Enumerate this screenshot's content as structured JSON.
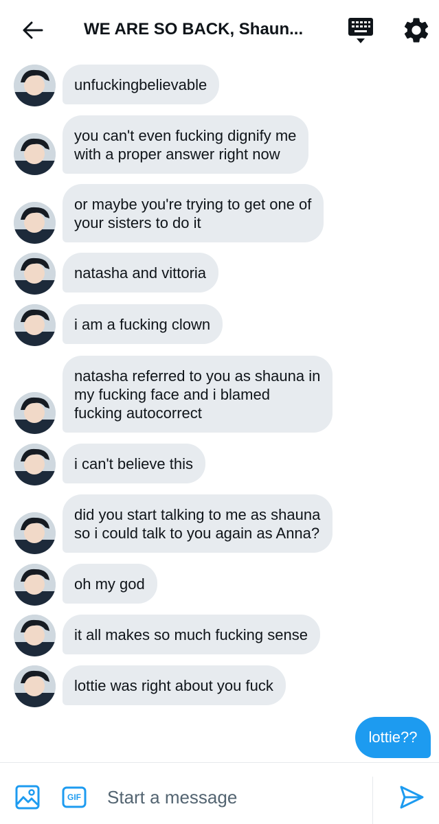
{
  "header": {
    "title": "WE ARE SO BACK, Shaun...",
    "back_icon": "arrow-left-icon",
    "keyboard_icon": "keyboard-icon",
    "settings_icon": "gear-icon"
  },
  "messages": [
    {
      "text": "unfuckingbelievable"
    },
    {
      "text": "you can't even fucking dignify me\nwith a proper answer right now"
    },
    {
      "text": "or maybe you're trying to get one of\nyour sisters to do it"
    },
    {
      "text": "natasha and vittoria"
    },
    {
      "text": "i am a fucking clown"
    },
    {
      "text": "natasha referred to you as shauna in\nmy fucking face and i blamed\nfucking autocorrect"
    },
    {
      "text": "i can't believe this"
    },
    {
      "text": "did you start talking to me as shauna\nso i could talk to you again as Anna?"
    },
    {
      "text": "oh my god"
    },
    {
      "text": "it all makes so much fucking sense"
    },
    {
      "text": "lottie was right about you fuck"
    }
  ],
  "sent_message": {
    "text": "lottie??"
  },
  "composer": {
    "placeholder": "Start a message",
    "value": "",
    "gif_label": "GIF",
    "image_icon": "image-icon",
    "send_icon": "send-icon"
  },
  "colors": {
    "accent": "#1d9bf0",
    "bubble_received": "#e7ebef",
    "text": "#0f1419",
    "placeholder": "#536471"
  }
}
